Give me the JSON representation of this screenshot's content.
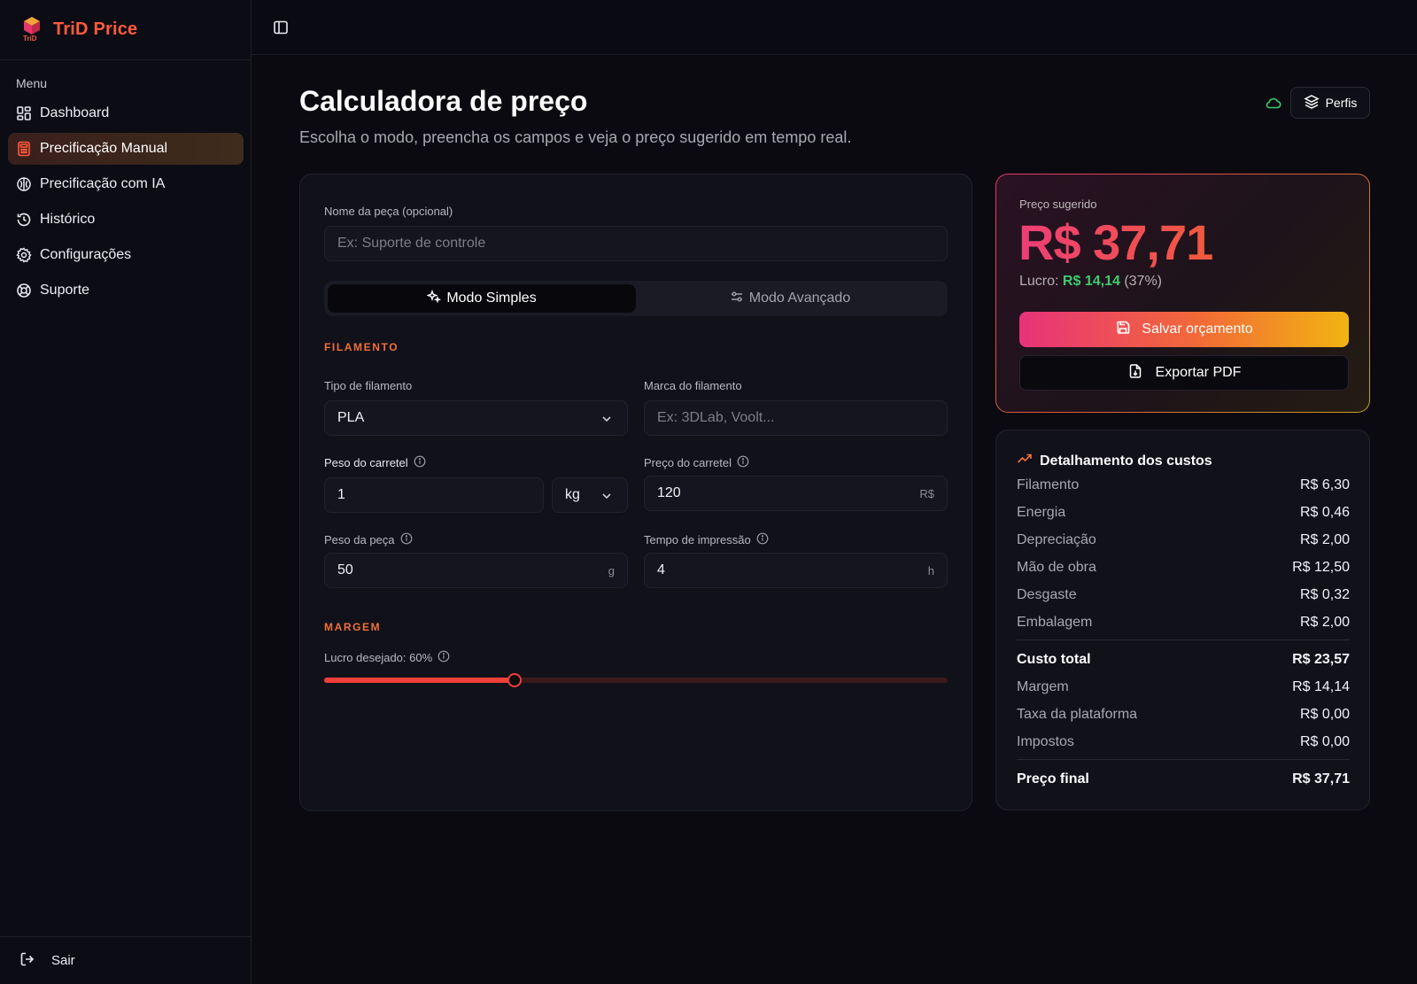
{
  "app": {
    "name": "TriD Price",
    "logo_text": "TriD"
  },
  "sidebar": {
    "menu_title": "Menu",
    "items": [
      {
        "label": "Dashboard",
        "icon": "dashboard-icon"
      },
      {
        "label": "Precificação Manual",
        "icon": "calculator-icon",
        "active": true
      },
      {
        "label": "Precificação com IA",
        "icon": "ai-brain-icon"
      },
      {
        "label": "Histórico",
        "icon": "history-icon"
      },
      {
        "label": "Configurações",
        "icon": "gear-icon"
      },
      {
        "label": "Suporte",
        "icon": "lifebuoy-icon"
      }
    ],
    "logout_label": "Sair"
  },
  "header": {
    "title": "Calculadora de preço",
    "subtitle": "Escolha o modo, preencha os campos e veja o preço sugerido em tempo real.",
    "profiles_label": "Perfis"
  },
  "form": {
    "name_label": "Nome da peça (opcional)",
    "name_placeholder": "Ex: Suporte de controle",
    "modes": {
      "simple": "Modo Simples",
      "advanced": "Modo Avançado",
      "selected": "simple"
    },
    "filament_section": "FILAMENTO",
    "type_label": "Tipo de filamento",
    "type_value": "PLA",
    "brand_label": "Marca do filamento",
    "brand_placeholder": "Ex: 3DLab, Voolt...",
    "spool_weight_label": "Peso do carretel",
    "spool_weight_value": "1",
    "spool_weight_unit": "kg",
    "spool_price_label": "Preço do carretel",
    "spool_price_value": "120",
    "spool_price_suffix": "R$",
    "part_weight_label": "Peso da peça",
    "part_weight_value": "50",
    "part_weight_suffix": "g",
    "print_time_label": "Tempo de impressão",
    "print_time_value": "4",
    "print_time_suffix": "h",
    "margin_section": "MARGEM",
    "profit_label": "Lucro desejado: 60%",
    "profit_fraction": 0.305
  },
  "price": {
    "label": "Preço sugerido",
    "value": "R$ 37,71",
    "profit_prefix": "Lucro:",
    "profit_value": "R$ 14,14",
    "profit_percent": "(37%)",
    "save_label": "Salvar orçamento",
    "pdf_label": "Exportar PDF"
  },
  "costs": {
    "title": "Detalhamento dos custos",
    "items": [
      {
        "label": "Filamento",
        "value": "R$ 6,30"
      },
      {
        "label": "Energia",
        "value": "R$ 0,46"
      },
      {
        "label": "Depreciação",
        "value": "R$ 2,00"
      },
      {
        "label": "Mão de obra",
        "value": "R$ 12,50"
      },
      {
        "label": "Desgaste",
        "value": "R$ 0,32"
      },
      {
        "label": "Embalagem",
        "value": "R$ 2,00"
      }
    ],
    "total": {
      "label": "Custo total",
      "value": "R$ 23,57"
    },
    "extras": [
      {
        "label": "Margem",
        "value": "R$ 14,14"
      },
      {
        "label": "Taxa da plataforma",
        "value": "R$ 0,00"
      },
      {
        "label": "Impostos",
        "value": "R$ 0,00"
      }
    ],
    "final": {
      "label": "Preço final",
      "value": "R$ 37,71"
    }
  },
  "colors": {
    "accent": "#f0403a",
    "success": "#3ecb6e",
    "brand": "#ff5a3c"
  }
}
